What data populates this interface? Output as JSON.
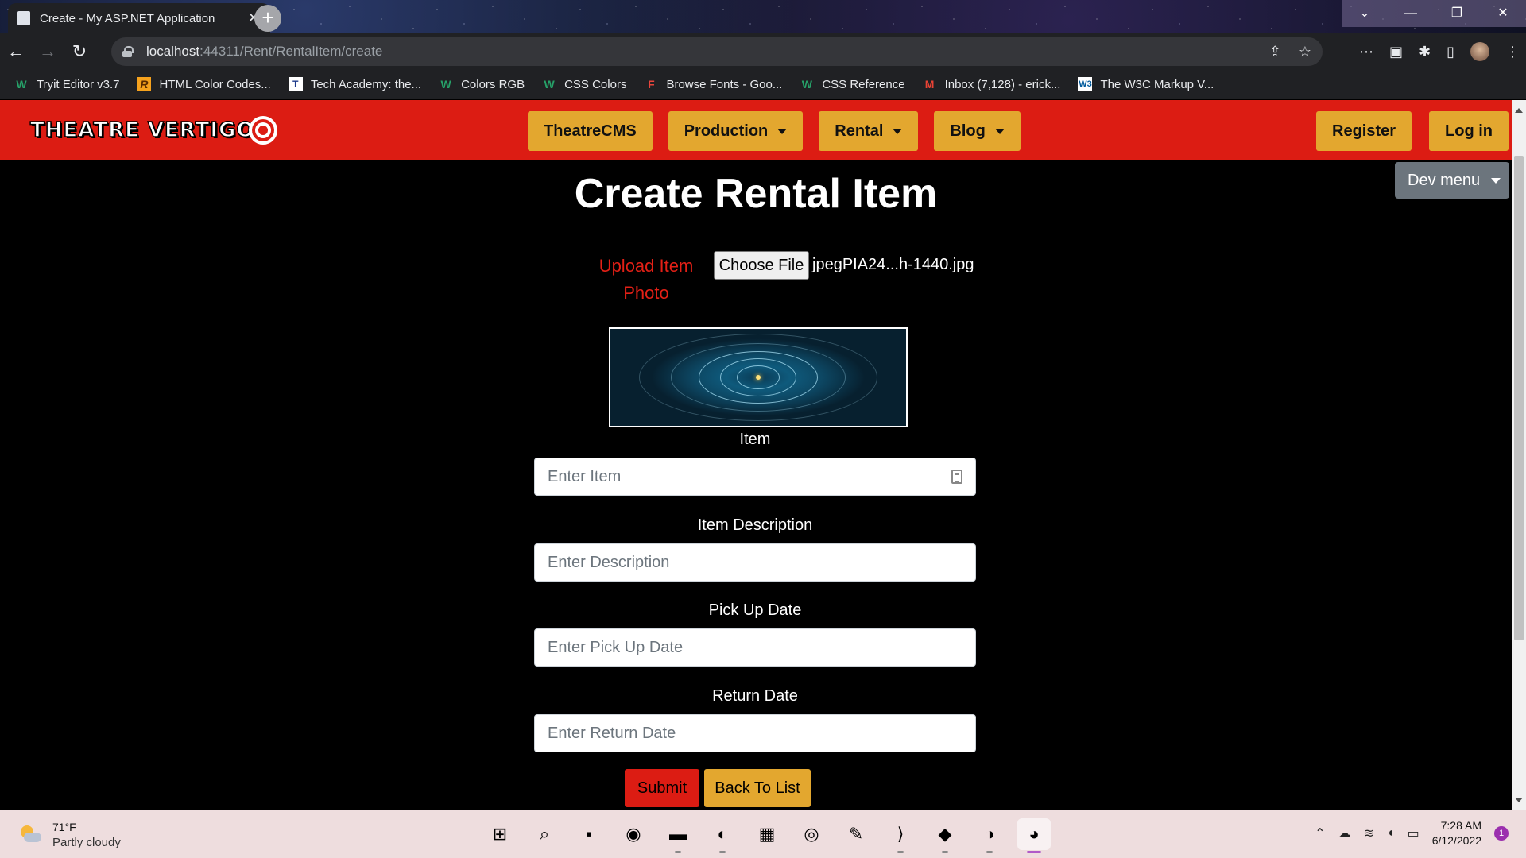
{
  "browser": {
    "tab_title": "Create - My ASP.NET Application",
    "tab_close": "✕",
    "new_tab": "+",
    "window_controls": [
      "⌄",
      "—",
      "❐",
      "✕"
    ],
    "nav": {
      "back": "←",
      "forward": "→",
      "reload": "↻"
    },
    "url_host": "localhost",
    "url_rest": ":44311/Rent/RentalItem/create",
    "omni_icons": [
      "⇪",
      "☆"
    ],
    "ext_icons": [
      "⋯",
      "▣",
      "✱",
      "▯",
      "⋮"
    ]
  },
  "bookmarks": [
    {
      "label": "Tryit Editor v3.7",
      "icon": "w3schools-icon",
      "glyph": "W",
      "cls": "w"
    },
    {
      "label": "HTML Color Codes...",
      "icon": "color-codes-icon",
      "glyph": "R",
      "cls": "r"
    },
    {
      "label": "Tech Academy: the...",
      "icon": "tech-academy-icon",
      "glyph": "T",
      "cls": "t"
    },
    {
      "label": "Colors RGB",
      "icon": "w3schools-icon",
      "glyph": "W",
      "cls": "w"
    },
    {
      "label": "CSS Colors",
      "icon": "w3schools-icon",
      "glyph": "W",
      "cls": "w"
    },
    {
      "label": "Browse Fonts - Goo...",
      "icon": "google-fonts-icon",
      "glyph": "F",
      "cls": "f"
    },
    {
      "label": "CSS Reference",
      "icon": "w3schools-icon",
      "glyph": "W",
      "cls": "w"
    },
    {
      "label": "Inbox (7,128) - erick...",
      "icon": "gmail-icon",
      "glyph": "M",
      "cls": "m"
    },
    {
      "label": "The W3C Markup V...",
      "icon": "w3c-icon",
      "glyph": "W3",
      "cls": "w3"
    }
  ],
  "site": {
    "logo": "THEATRE VERTIGO",
    "nav_items": [
      "TheatreCMS",
      "Production",
      "Rental",
      "Blog"
    ],
    "auth": {
      "register": "Register",
      "login": "Log in"
    },
    "dev_menu": "Dev menu"
  },
  "form": {
    "title": "Create Rental Item",
    "upload_label": "Upload Item Photo",
    "choose_file": "Choose File",
    "file_name": "jpegPIA24...h-1440.jpg",
    "fields": [
      {
        "label": "Item",
        "placeholder": "Enter Item"
      },
      {
        "label": "Item Description",
        "placeholder": "Enter Description"
      },
      {
        "label": "Pick Up Date",
        "placeholder": "Enter Pick Up Date"
      },
      {
        "label": "Return Date",
        "placeholder": "Enter Return Date"
      }
    ],
    "submit": "Submit",
    "back": "Back To List"
  },
  "taskbar": {
    "temperature": "71°F",
    "condition": "Partly cloudy",
    "apps": [
      "⊞",
      "⌕",
      "▪",
      "◉",
      "▬",
      "◐",
      "▦",
      "◎",
      "✎",
      "⟩",
      "◆",
      "◑",
      "◕"
    ],
    "tray": [
      "⌃",
      "☁",
      "≋",
      "◖",
      "▭"
    ],
    "time": "7:28 AM",
    "date": "6/12/2022",
    "notifications": "1"
  },
  "colors": {
    "brand_red": "#dc1c13",
    "brand_gold": "#e3a72f",
    "dev_gray": "#6c757d"
  }
}
